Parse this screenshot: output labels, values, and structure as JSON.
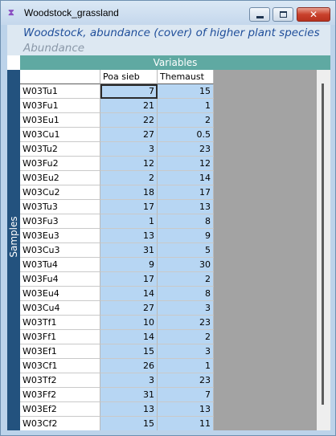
{
  "window": {
    "title": "Woodstock_grassland",
    "icon": "app-icon",
    "controls": {
      "minimize": "minimize-icon",
      "maximize": "maximize-icon",
      "close": "close-icon"
    }
  },
  "dataset": {
    "title": "Woodstock, abundance (cover) of higher plant species",
    "measure": "Abundance"
  },
  "axes": {
    "columns_label": "Variables",
    "rows_label": "Samples"
  },
  "table": {
    "columns": [
      "Poa sieb",
      "Themaust"
    ],
    "rows": [
      {
        "sample": "W03Tu1",
        "values": [
          "7",
          "15"
        ]
      },
      {
        "sample": "W03Fu1",
        "values": [
          "21",
          "1"
        ]
      },
      {
        "sample": "W03Eu1",
        "values": [
          "22",
          "2"
        ]
      },
      {
        "sample": "W03Cu1",
        "values": [
          "27",
          "0.5"
        ]
      },
      {
        "sample": "W03Tu2",
        "values": [
          "3",
          "23"
        ]
      },
      {
        "sample": "W03Fu2",
        "values": [
          "12",
          "12"
        ]
      },
      {
        "sample": "W03Eu2",
        "values": [
          "2",
          "14"
        ]
      },
      {
        "sample": "W03Cu2",
        "values": [
          "18",
          "17"
        ]
      },
      {
        "sample": "W03Tu3",
        "values": [
          "17",
          "13"
        ]
      },
      {
        "sample": "W03Fu3",
        "values": [
          "1",
          "8"
        ]
      },
      {
        "sample": "W03Eu3",
        "values": [
          "13",
          "9"
        ]
      },
      {
        "sample": "W03Cu3",
        "values": [
          "31",
          "5"
        ]
      },
      {
        "sample": "W03Tu4",
        "values": [
          "9",
          "30"
        ]
      },
      {
        "sample": "W03Fu4",
        "values": [
          "17",
          "2"
        ]
      },
      {
        "sample": "W03Eu4",
        "values": [
          "14",
          "8"
        ]
      },
      {
        "sample": "W03Cu4",
        "values": [
          "27",
          "3"
        ]
      },
      {
        "sample": "W03Tf1",
        "values": [
          "10",
          "23"
        ]
      },
      {
        "sample": "W03Ff1",
        "values": [
          "14",
          "2"
        ]
      },
      {
        "sample": "W03Ef1",
        "values": [
          "15",
          "3"
        ]
      },
      {
        "sample": "W03Cf1",
        "values": [
          "26",
          "1"
        ]
      },
      {
        "sample": "W03Tf2",
        "values": [
          "3",
          "23"
        ]
      },
      {
        "sample": "W03Ff2",
        "values": [
          "31",
          "7"
        ]
      },
      {
        "sample": "W03Ef2",
        "values": [
          "13",
          "13"
        ]
      },
      {
        "sample": "W03Cf2",
        "values": [
          "15",
          "11"
        ]
      }
    ]
  },
  "colors": {
    "accent_teal": "#5fa9a2",
    "samples_navy": "#23527e",
    "cell_blue": "#b7d6f3",
    "title_blue": "#1f4e9a"
  }
}
